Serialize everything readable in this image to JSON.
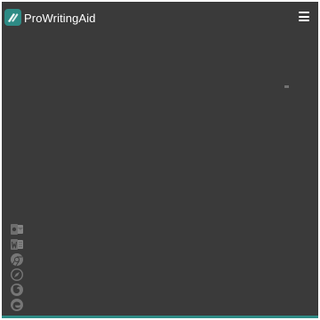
{
  "header": {
    "brand_name": "ProWritingAid",
    "logo_icon": "prowritingaid-logo-icon",
    "menu_icon": "hamburger-menu-icon"
  },
  "integrations": [
    {
      "name": "outlook-icon"
    },
    {
      "name": "word-icon"
    },
    {
      "name": "chrome-icon"
    },
    {
      "name": "safari-icon"
    },
    {
      "name": "firefox-icon"
    },
    {
      "name": "edge-icon"
    }
  ],
  "colors": {
    "background": "#3a3a3a",
    "brand_teal": "#2e8b85",
    "text": "#ffffff"
  }
}
